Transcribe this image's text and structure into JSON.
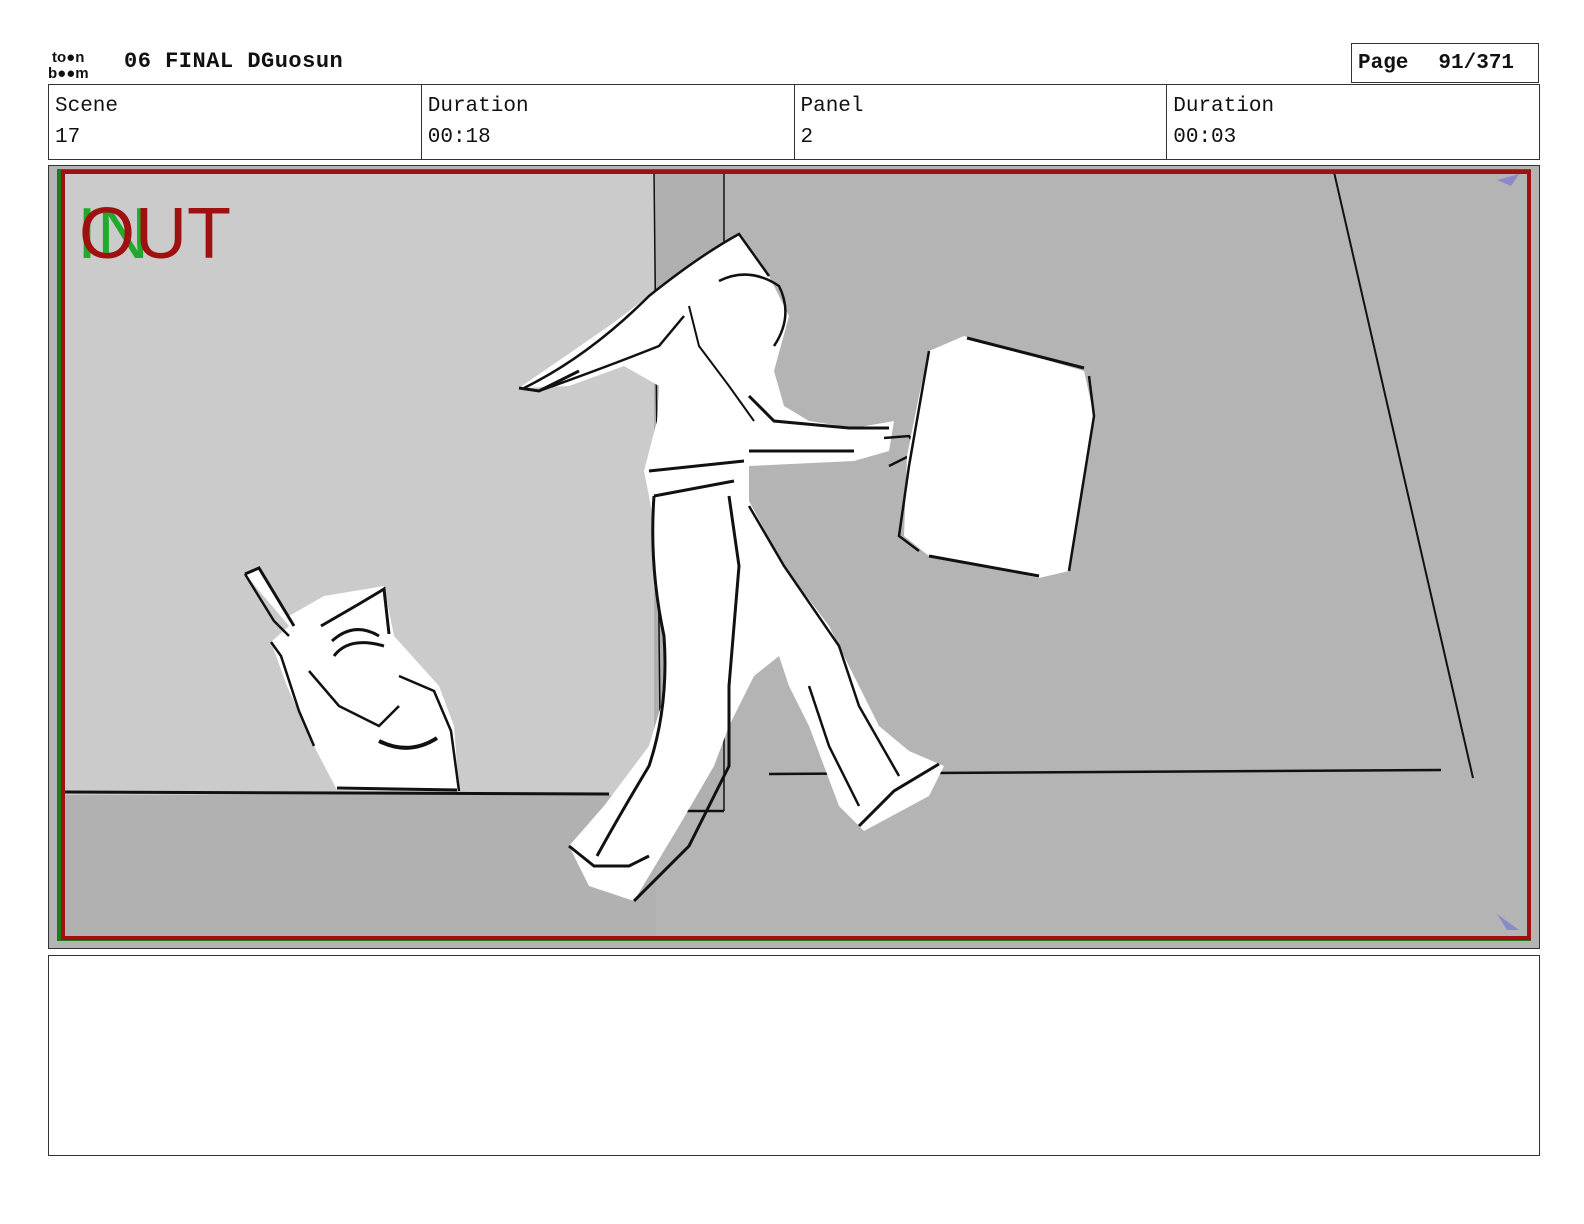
{
  "header": {
    "logo_text_top": "to●n",
    "logo_text_bottom": "b●●m",
    "title": "06 FINAL DGuosun",
    "page_label": "Page",
    "page_value": "91/371"
  },
  "info": {
    "scene_label": "Scene",
    "scene_value": "17",
    "scene_duration_label": "Duration",
    "scene_duration_value": "00:18",
    "panel_label": "Panel",
    "panel_value": "2",
    "panel_duration_label": "Duration",
    "panel_duration_value": "00:03"
  },
  "panel": {
    "in_marker": "IN",
    "out_marker": "OUT",
    "in_color": "#1faa2e",
    "out_color": "#a01010",
    "frame_colors": [
      "#a01010",
      "#1e7a1e"
    ]
  },
  "notes": {
    "text": ""
  }
}
